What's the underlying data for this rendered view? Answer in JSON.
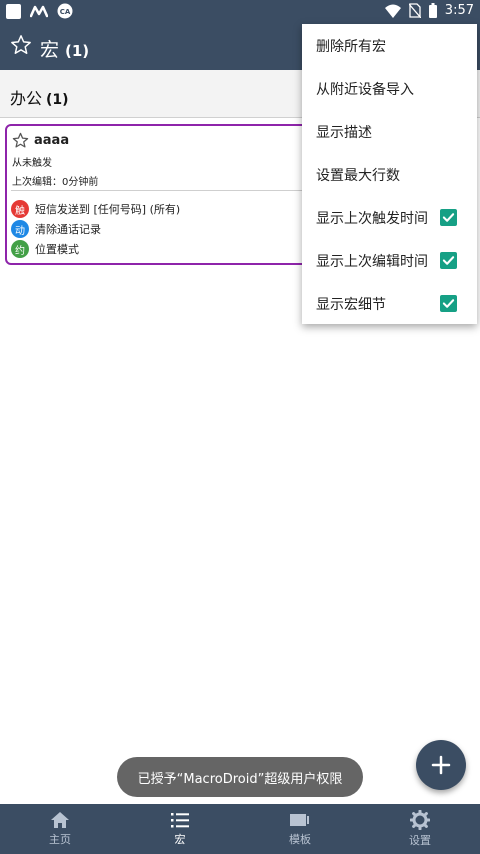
{
  "statusbar": {
    "time": "3:57",
    "left_icons": [
      "square-icon",
      "m-icon",
      "ca-icon"
    ],
    "right_icons": [
      "wifi-icon",
      "no-sim-icon",
      "battery-icon"
    ]
  },
  "appbar": {
    "title": "宏",
    "count": "(1)"
  },
  "group": {
    "title": "办公",
    "count": "(1)"
  },
  "macro_card": {
    "name": "aaaa",
    "last_triggered": "从未触发",
    "last_edited": "上次编辑：0分钟前",
    "rows": [
      {
        "badge": "触",
        "badge_color": "#e53935",
        "text": "短信发送到 [任何号码] (所有)"
      },
      {
        "badge": "动",
        "badge_color": "#1e88e5",
        "text": "清除通话记录"
      },
      {
        "badge": "约",
        "badge_color": "#43a047",
        "text": "位置模式"
      }
    ],
    "border_color": "#8e24aa"
  },
  "menu": {
    "items": [
      {
        "label": "删除所有宏",
        "checked": null
      },
      {
        "label": "从附近设备导入",
        "checked": null
      },
      {
        "label": "显示描述",
        "checked": null
      },
      {
        "label": "设置最大行数",
        "checked": null
      },
      {
        "label": "显示上次触发时间",
        "checked": true
      },
      {
        "label": "显示上次编辑时间",
        "checked": true
      },
      {
        "label": "显示宏细节",
        "checked": true
      }
    ],
    "check_color": "#16a085"
  },
  "toast": {
    "text": "已授予“MacroDroid”超级用户权限"
  },
  "bottom_nav": {
    "items": [
      {
        "label": "主页",
        "icon": "home-icon",
        "active": false
      },
      {
        "label": "宏",
        "icon": "list-icon",
        "active": true
      },
      {
        "label": "模板",
        "icon": "templates-icon",
        "active": false
      },
      {
        "label": "设置",
        "icon": "gear-icon",
        "active": false
      }
    ]
  },
  "colors": {
    "primary": "#3b4d63",
    "accent": "#16a085"
  }
}
